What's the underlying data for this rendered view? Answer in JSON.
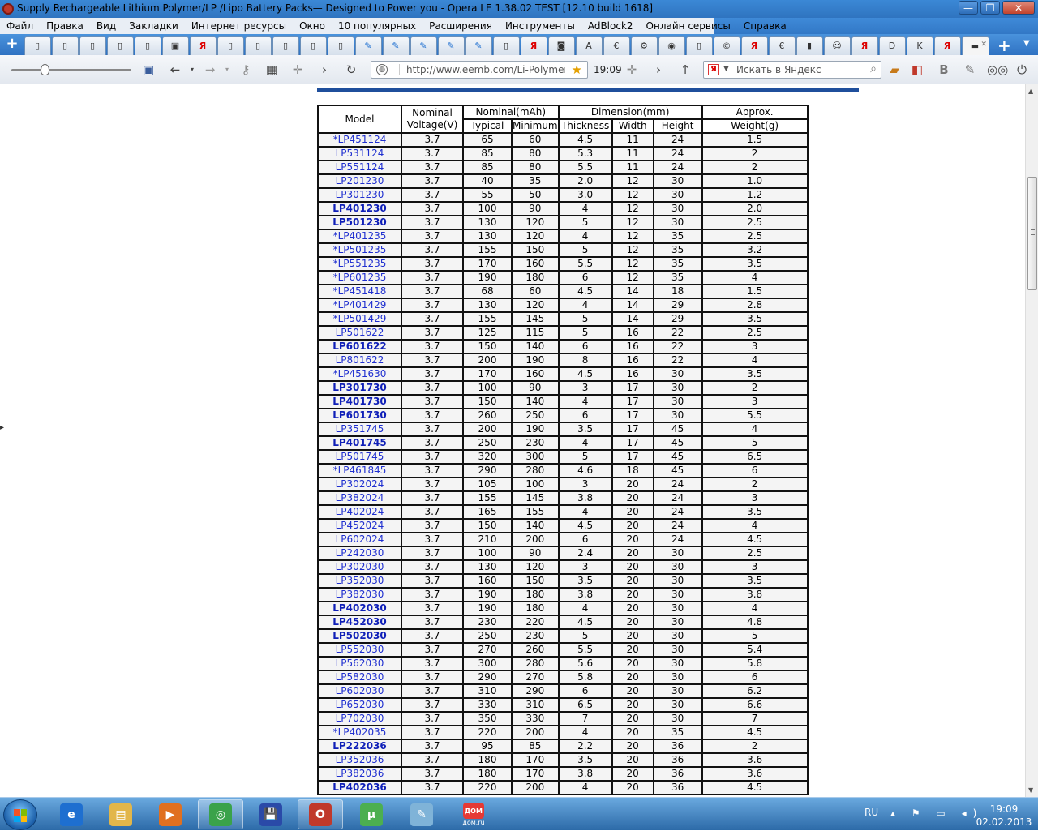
{
  "window": {
    "title": "Supply Rechargeable Lithium Polymer/LP /Lipo Battery Packs— Designed to Power you - Opera LE 1.38.02 TEST [12.10 build 1618]",
    "buttons": {
      "minimize": "—",
      "maximize": "❐",
      "close": "✕"
    }
  },
  "menu": [
    "Файл",
    "Правка",
    "Вид",
    "Закладки",
    "Интернет ресурсы",
    "Окно",
    "10 популярных",
    "Расширения",
    "Инструменты",
    "AdBlock2",
    "Онлайн сервисы",
    "Справка"
  ],
  "tabs": [
    {
      "icon": "page-icon",
      "glyph": "▯"
    },
    {
      "icon": "page-icon",
      "glyph": "▯"
    },
    {
      "icon": "page-icon",
      "glyph": "▯"
    },
    {
      "icon": "page-icon",
      "glyph": "▯"
    },
    {
      "icon": "page-icon",
      "glyph": "▯"
    },
    {
      "icon": "window-icon",
      "glyph": "▣"
    },
    {
      "icon": "yandex-icon",
      "glyph": "Я"
    },
    {
      "icon": "page-icon",
      "glyph": "▯"
    },
    {
      "icon": "page-icon",
      "glyph": "▯"
    },
    {
      "icon": "page-icon",
      "glyph": "▯"
    },
    {
      "icon": "page-icon",
      "glyph": "▯"
    },
    {
      "icon": "page-icon",
      "glyph": "▯"
    },
    {
      "icon": "pin-icon",
      "glyph": "✎"
    },
    {
      "icon": "pin-icon",
      "glyph": "✎"
    },
    {
      "icon": "pin-icon",
      "glyph": "✎"
    },
    {
      "icon": "pin-icon",
      "glyph": "✎"
    },
    {
      "icon": "pin-icon",
      "glyph": "✎"
    },
    {
      "icon": "page-icon",
      "glyph": "▯"
    },
    {
      "icon": "yandex-icon",
      "glyph": "Я"
    },
    {
      "icon": "camera-icon",
      "glyph": "◙"
    },
    {
      "icon": "a-icon",
      "glyph": "A"
    },
    {
      "icon": "e-icon",
      "glyph": "€"
    },
    {
      "icon": "gear-icon",
      "glyph": "⚙"
    },
    {
      "icon": "globe-icon",
      "glyph": "◉"
    },
    {
      "icon": "page-icon",
      "glyph": "▯"
    },
    {
      "icon": "c-icon",
      "glyph": "©"
    },
    {
      "icon": "yandex-icon",
      "glyph": "Я"
    },
    {
      "icon": "e-icon",
      "glyph": "€"
    },
    {
      "icon": "bookmark-icon",
      "glyph": "▮"
    },
    {
      "icon": "face-icon",
      "glyph": "☺"
    },
    {
      "icon": "yandex-icon",
      "glyph": "Я"
    },
    {
      "icon": "d-icon",
      "glyph": "D"
    },
    {
      "icon": "k-icon",
      "glyph": "K"
    },
    {
      "icon": "yandex-icon",
      "glyph": "Я"
    },
    {
      "icon": "active-page-icon",
      "glyph": "▬"
    }
  ],
  "address": {
    "url": "http://www.eemb.com/Li-Polymer_b",
    "time": "19:09",
    "search_placeholder": "Искать в Яндекс",
    "search_engine": "Я"
  },
  "table": {
    "headers": {
      "model": "Model",
      "voltage_line1": "Nominal",
      "voltage_line2": "Voltage(V)",
      "capacity": "Nominal(mAh)",
      "typical": "Typical",
      "minimum": "Minimum",
      "dimension": "Dimension(mm)",
      "thickness": "Thickness",
      "width": "Width",
      "height": "Height",
      "weight_line1": "Approx.",
      "weight_line2": "Weight(g)"
    },
    "rows": [
      [
        "*LP451124",
        "3.7",
        "65",
        "60",
        "4.5",
        "11",
        "24",
        "1.5",
        false
      ],
      [
        "LP531124",
        "3.7",
        "85",
        "80",
        "5.3",
        "11",
        "24",
        "2",
        false
      ],
      [
        "LP551124",
        "3.7",
        "85",
        "80",
        "5.5",
        "11",
        "24",
        "2",
        false
      ],
      [
        "LP201230",
        "3.7",
        "40",
        "35",
        "2.0",
        "12",
        "30",
        "1.0",
        false
      ],
      [
        "LP301230",
        "3.7",
        "55",
        "50",
        "3.0",
        "12",
        "30",
        "1.2",
        false
      ],
      [
        "LP401230",
        "3.7",
        "100",
        "90",
        "4",
        "12",
        "30",
        "2.0",
        true
      ],
      [
        "LP501230",
        "3.7",
        "130",
        "120",
        "5",
        "12",
        "30",
        "2.5",
        true
      ],
      [
        "*LP401235",
        "3.7",
        "130",
        "120",
        "4",
        "12",
        "35",
        "2.5",
        false
      ],
      [
        "*LP501235",
        "3.7",
        "155",
        "150",
        "5",
        "12",
        "35",
        "3.2",
        false
      ],
      [
        "*LP551235",
        "3.7",
        "170",
        "160",
        "5.5",
        "12",
        "35",
        "3.5",
        false
      ],
      [
        "*LP601235",
        "3.7",
        "190",
        "180",
        "6",
        "12",
        "35",
        "4",
        false
      ],
      [
        "*LP451418",
        "3.7",
        "68",
        "60",
        "4.5",
        "14",
        "18",
        "1.5",
        false
      ],
      [
        "*LP401429",
        "3.7",
        "130",
        "120",
        "4",
        "14",
        "29",
        "2.8",
        false
      ],
      [
        "*LP501429",
        "3.7",
        "155",
        "145",
        "5",
        "14",
        "29",
        "3.5",
        false
      ],
      [
        "LP501622",
        "3.7",
        "125",
        "115",
        "5",
        "16",
        "22",
        "2.5",
        false
      ],
      [
        "LP601622",
        "3.7",
        "150",
        "140",
        "6",
        "16",
        "22",
        "3",
        true
      ],
      [
        "LP801622",
        "3.7",
        "200",
        "190",
        "8",
        "16",
        "22",
        "4",
        false
      ],
      [
        "*LP451630",
        "3.7",
        "170",
        "160",
        "4.5",
        "16",
        "30",
        "3.5",
        false
      ],
      [
        "LP301730",
        "3.7",
        "100",
        "90",
        "3",
        "17",
        "30",
        "2",
        true
      ],
      [
        "LP401730",
        "3.7",
        "150",
        "140",
        "4",
        "17",
        "30",
        "3",
        true
      ],
      [
        "LP601730",
        "3.7",
        "260",
        "250",
        "6",
        "17",
        "30",
        "5.5",
        true
      ],
      [
        "LP351745",
        "3.7",
        "200",
        "190",
        "3.5",
        "17",
        "45",
        "4",
        false
      ],
      [
        "LP401745",
        "3.7",
        "250",
        "230",
        "4",
        "17",
        "45",
        "5",
        true
      ],
      [
        "LP501745",
        "3.7",
        "320",
        "300",
        "5",
        "17",
        "45",
        "6.5",
        false
      ],
      [
        "*LP461845",
        "3.7",
        "290",
        "280",
        "4.6",
        "18",
        "45",
        "6",
        false
      ],
      [
        "LP302024",
        "3.7",
        "105",
        "100",
        "3",
        "20",
        "24",
        "2",
        false
      ],
      [
        "LP382024",
        "3.7",
        "155",
        "145",
        "3.8",
        "20",
        "24",
        "3",
        false
      ],
      [
        "LP402024",
        "3.7",
        "165",
        "155",
        "4",
        "20",
        "24",
        "3.5",
        false
      ],
      [
        "LP452024",
        "3.7",
        "150",
        "140",
        "4.5",
        "20",
        "24",
        "4",
        false
      ],
      [
        "LP602024",
        "3.7",
        "210",
        "200",
        "6",
        "20",
        "24",
        "4.5",
        false
      ],
      [
        "LP242030",
        "3.7",
        "100",
        "90",
        "2.4",
        "20",
        "30",
        "2.5",
        false
      ],
      [
        "LP302030",
        "3.7",
        "130",
        "120",
        "3",
        "20",
        "30",
        "3",
        false
      ],
      [
        "LP352030",
        "3.7",
        "160",
        "150",
        "3.5",
        "20",
        "30",
        "3.5",
        false
      ],
      [
        "LP382030",
        "3.7",
        "190",
        "180",
        "3.8",
        "20",
        "30",
        "3.8",
        false
      ],
      [
        "LP402030",
        "3.7",
        "190",
        "180",
        "4",
        "20",
        "30",
        "4",
        true
      ],
      [
        "LP452030",
        "3.7",
        "230",
        "220",
        "4.5",
        "20",
        "30",
        "4.8",
        true
      ],
      [
        "LP502030",
        "3.7",
        "250",
        "230",
        "5",
        "20",
        "30",
        "5",
        true
      ],
      [
        "LP552030",
        "3.7",
        "270",
        "260",
        "5.5",
        "20",
        "30",
        "5.4",
        false
      ],
      [
        "LP562030",
        "3.7",
        "300",
        "280",
        "5.6",
        "20",
        "30",
        "5.8",
        false
      ],
      [
        "LP582030",
        "3.7",
        "290",
        "270",
        "5.8",
        "20",
        "30",
        "6",
        false
      ],
      [
        "LP602030",
        "3.7",
        "310",
        "290",
        "6",
        "20",
        "30",
        "6.2",
        false
      ],
      [
        "LP652030",
        "3.7",
        "330",
        "310",
        "6.5",
        "20",
        "30",
        "6.6",
        false
      ],
      [
        "LP702030",
        "3.7",
        "350",
        "330",
        "7",
        "20",
        "30",
        "7",
        false
      ],
      [
        "*LP402035",
        "3.7",
        "220",
        "200",
        "4",
        "20",
        "35",
        "4.5",
        false
      ],
      [
        "LP222036",
        "3.7",
        "95",
        "85",
        "2.2",
        "20",
        "36",
        "2",
        true
      ],
      [
        "LP352036",
        "3.7",
        "180",
        "170",
        "3.5",
        "20",
        "36",
        "3.6",
        false
      ],
      [
        "LP382036",
        "3.7",
        "180",
        "170",
        "3.8",
        "20",
        "36",
        "3.6",
        false
      ],
      [
        "LP402036",
        "3.7",
        "220",
        "200",
        "4",
        "20",
        "36",
        "4.5",
        true
      ]
    ]
  },
  "taskbar": {
    "apps": [
      {
        "name": "ie-icon",
        "glyph": "e",
        "color": "#1e6fd0",
        "open": false
      },
      {
        "name": "explorer-icon",
        "glyph": "▤",
        "color": "#e2b64a",
        "open": false
      },
      {
        "name": "media-player-icon",
        "glyph": "▶",
        "color": "#e07020",
        "open": false
      },
      {
        "name": "network-icon",
        "glyph": "◎",
        "color": "#3aa24a",
        "open": true
      },
      {
        "name": "save-app-icon",
        "glyph": "💾",
        "color": "#2a4aa8",
        "open": false
      },
      {
        "name": "opera-icon",
        "glyph": "O",
        "color": "#c0392b",
        "open": true
      },
      {
        "name": "utorrent-icon",
        "glyph": "µ",
        "color": "#4caf50",
        "open": false
      },
      {
        "name": "notes-icon",
        "glyph": "✎",
        "color": "#7fb3d8",
        "open": false
      },
      {
        "name": "domru-icon",
        "glyph": "ДОМ",
        "color": "#e53935",
        "open": false,
        "label": "дом.ru"
      }
    ],
    "language": "RU",
    "time": "19:09",
    "date": "02.02.2013"
  },
  "colors": {
    "link": "#1f2fd0",
    "accent_bar": "#1f4f9c"
  }
}
